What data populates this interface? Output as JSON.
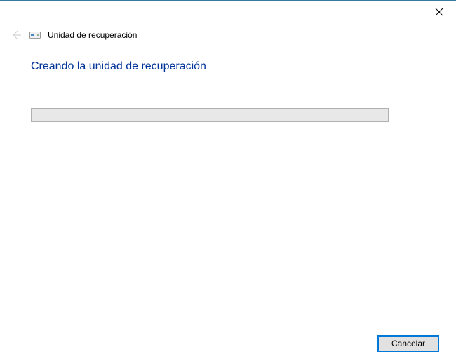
{
  "window": {
    "title": "Unidad de recuperación"
  },
  "content": {
    "heading": "Creando la unidad de recuperación"
  },
  "footer": {
    "cancel_label": "Cancelar"
  }
}
